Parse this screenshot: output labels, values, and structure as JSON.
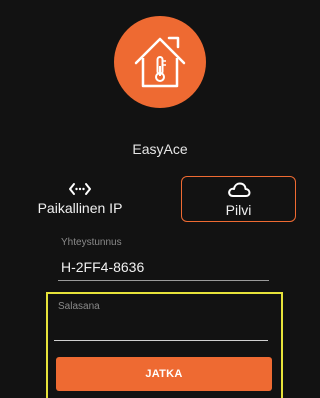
{
  "app": {
    "name": "EasyAce",
    "logo_icon": "house-thermometer-icon"
  },
  "modes": {
    "local": {
      "label": "Paikallinen IP",
      "icon": "network-arrows-icon"
    },
    "cloud": {
      "label": "Pilvi",
      "icon": "cloud-icon",
      "selected": true
    }
  },
  "form": {
    "connection_label": "Yhteystunnus",
    "connection_value": "H-2FF4-8636",
    "password_label": "Salasana",
    "password_value": ""
  },
  "button": {
    "label": "JATKA"
  },
  "colors": {
    "accent": "#ee6a32",
    "background": "#121212",
    "highlight": "#e6e23a"
  }
}
